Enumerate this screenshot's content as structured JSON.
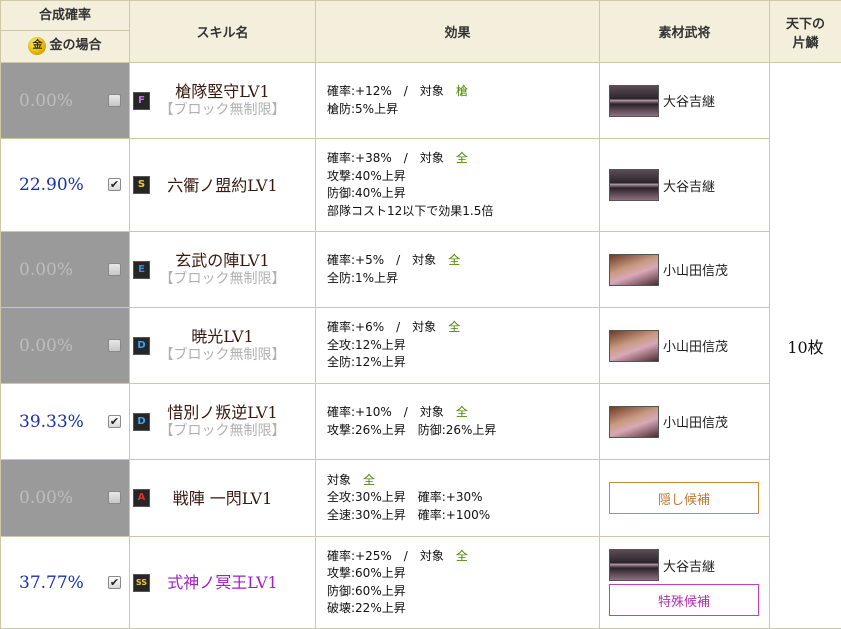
{
  "header": {
    "rate_title": "合成確率",
    "gold_icon": "金",
    "gold_label": "金の場合",
    "skill_name": "スキル名",
    "effect": "効果",
    "material": "素材武将",
    "tenka_line1": "天下の",
    "tenka_line2": "片鱗"
  },
  "tenka_count": "10枚",
  "rows": [
    {
      "rate": "0.00%",
      "checked": false,
      "rank": "F",
      "rank_color": "#c070e0",
      "skill_name": "槍隊堅守LV1",
      "skill_sub": "【ブロック無制限】",
      "effect_line1_label": "確率:+12%　/　対象",
      "effect_line1_target": "槍",
      "effect_lines": [
        "槍防:5%上昇"
      ],
      "material_name": "大谷吉継"
    },
    {
      "rate": "22.90%",
      "checked": true,
      "rank": "S",
      "rank_color": "#f0d020",
      "skill_name": "六衢ノ盟約LV1",
      "skill_sub": "",
      "effect_line1_label": "確率:+38%　/　対象",
      "effect_line1_target": "全",
      "effect_lines": [
        "攻撃:40%上昇",
        "防御:40%上昇",
        "部隊コスト12以下で効果1.5倍"
      ],
      "material_name": "大谷吉継"
    },
    {
      "rate": "0.00%",
      "checked": false,
      "rank": "E",
      "rank_color": "#3a8ae0",
      "skill_name": "玄武の陣LV1",
      "skill_sub": "【ブロック無制限】",
      "effect_line1_label": "確率:+5%　/　対象",
      "effect_line1_target": "全",
      "effect_lines": [
        "全防:1%上昇"
      ],
      "material_name": "小山田信茂"
    },
    {
      "rate": "0.00%",
      "checked": false,
      "rank": "D",
      "rank_color": "#40a0f0",
      "skill_name": "暁光LV1",
      "skill_sub": "【ブロック無制限】",
      "effect_line1_label": "確率:+6%　/　対象",
      "effect_line1_target": "全",
      "effect_lines": [
        "全攻:12%上昇",
        "全防:12%上昇"
      ],
      "material_name": "小山田信茂"
    },
    {
      "rate": "39.33%",
      "checked": true,
      "rank": "D",
      "rank_color": "#40a0f0",
      "skill_name": "惜別ノ叛逆LV1",
      "skill_sub": "【ブロック無制限】",
      "effect_line1_label": "確率:+10%　/　対象",
      "effect_line1_target": "全",
      "effect_lines": [
        "攻撃:26%上昇　防御:26%上昇"
      ],
      "material_name": "小山田信茂"
    },
    {
      "rate": "0.00%",
      "checked": false,
      "rank": "A",
      "rank_color": "#e03030",
      "skill_name": "戦陣 一閃LV1",
      "skill_sub": "",
      "effect_line1_label": "対象",
      "effect_line1_target": "全",
      "effect_lines": [
        "全攻:30%上昇　確率:+30%",
        "全速:30%上昇　確率:+100%"
      ],
      "candidate_label": "隠し候補"
    },
    {
      "rate": "37.77%",
      "checked": true,
      "rank": "SS",
      "rank_color": "#f0d020",
      "skill_name": "式神ノ冥王LV1",
      "skill_sub": "",
      "effect_line1_label": "確率:+25%　/　対象",
      "effect_line1_target": "全",
      "effect_lines": [
        "攻撃:60%上昇",
        "防御:60%上昇",
        "破壊:22%上昇"
      ],
      "material_name": "大谷吉継",
      "candidate_label": "特殊候補"
    }
  ]
}
